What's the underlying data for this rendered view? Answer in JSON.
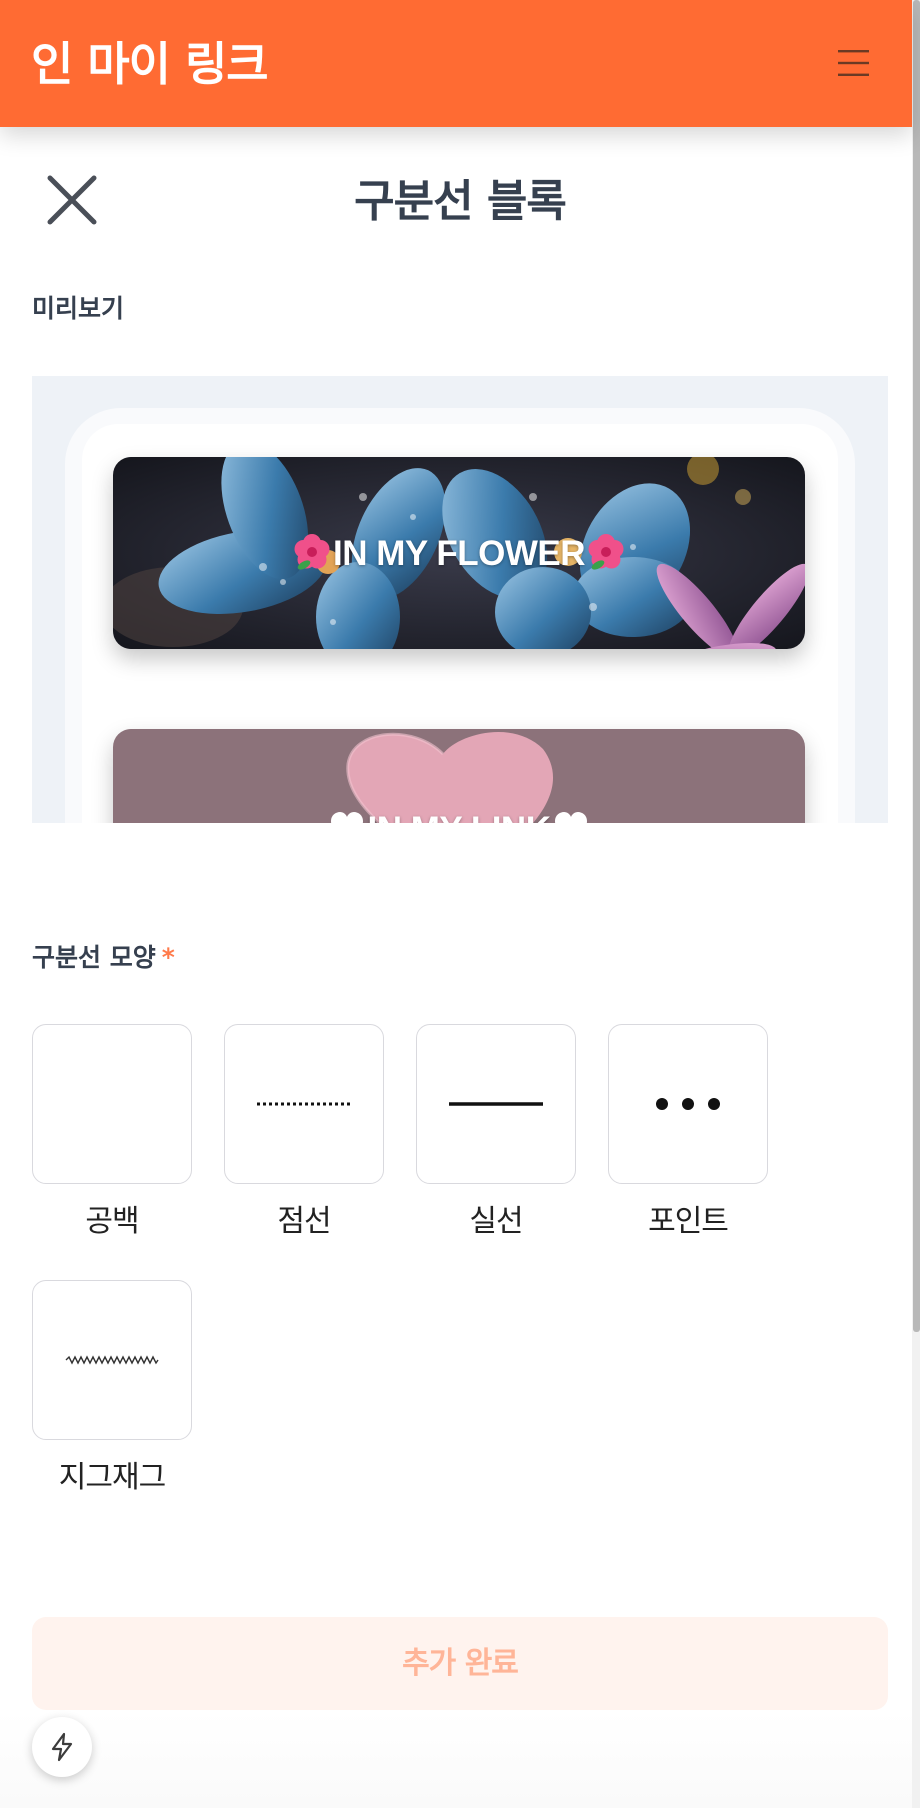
{
  "header": {
    "brand": "인 마이 링크",
    "menu_icon": "hamburger-menu-icon",
    "background_color": "#ff6b33"
  },
  "page": {
    "title": "구분선 블록",
    "close_icon": "close-icon"
  },
  "preview": {
    "label": "미리보기",
    "cards": [
      {
        "title": "IN MY FLOWER",
        "emoji": "hibiscus"
      },
      {
        "title": "IN MY LINK",
        "emoji": "heart"
      }
    ]
  },
  "divider_shape": {
    "label": "구분선 모양",
    "required_mark": "*",
    "options": [
      {
        "label": "공백",
        "icon": "blank-divider-icon"
      },
      {
        "label": "점선",
        "icon": "dotted-line-icon"
      },
      {
        "label": "실선",
        "icon": "solid-line-icon"
      },
      {
        "label": "포인트",
        "icon": "three-dots-icon"
      },
      {
        "label": "지그재그",
        "icon": "zigzag-line-icon"
      }
    ]
  },
  "actions": {
    "submit_label": "추가 완료",
    "submit_enabled": false,
    "bolt_icon": "lightning-bolt-icon"
  },
  "colors": {
    "accent": "#ff6b33",
    "submit_bg_disabled": "#fff3ee",
    "submit_text_disabled": "#ffb598",
    "required": "#ff7a4a"
  }
}
